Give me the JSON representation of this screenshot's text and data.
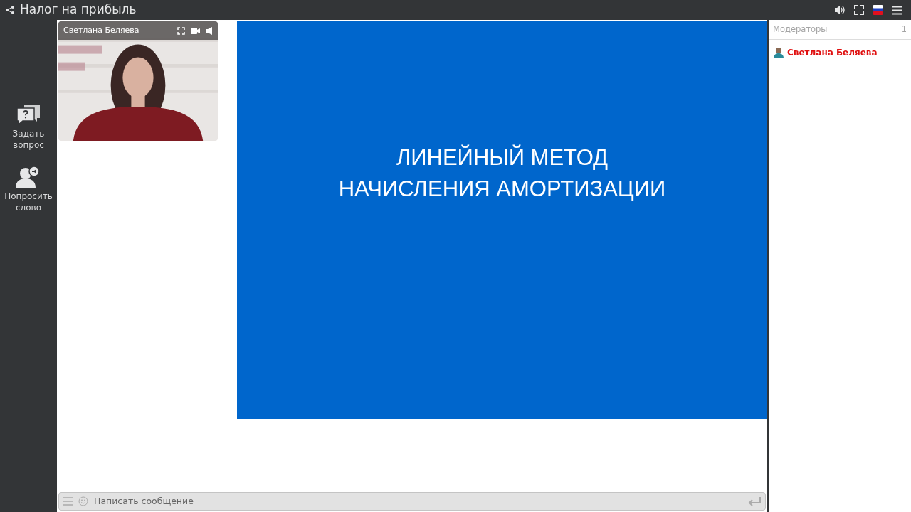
{
  "header": {
    "title": "Налог на прибыль"
  },
  "sidebar": {
    "items": [
      {
        "kind": "question",
        "label": "Задать вопрос"
      },
      {
        "kind": "speak",
        "label": "Попросить слово"
      }
    ]
  },
  "video": {
    "name": "Светлана Беляева",
    "kind": "picture"
  },
  "slide": {
    "lines": [
      "ЛИНЕЙНЫЙ МЕТОД",
      "НАЧИСЛЕНИЯ АМОРТИЗАЦИИ"
    ]
  },
  "chat": {
    "placeholder": "Написать сообщение"
  },
  "moderators": {
    "title": "Модераторы",
    "count": "1",
    "items": [
      {
        "name": "Светлана Беляева"
      }
    ]
  }
}
